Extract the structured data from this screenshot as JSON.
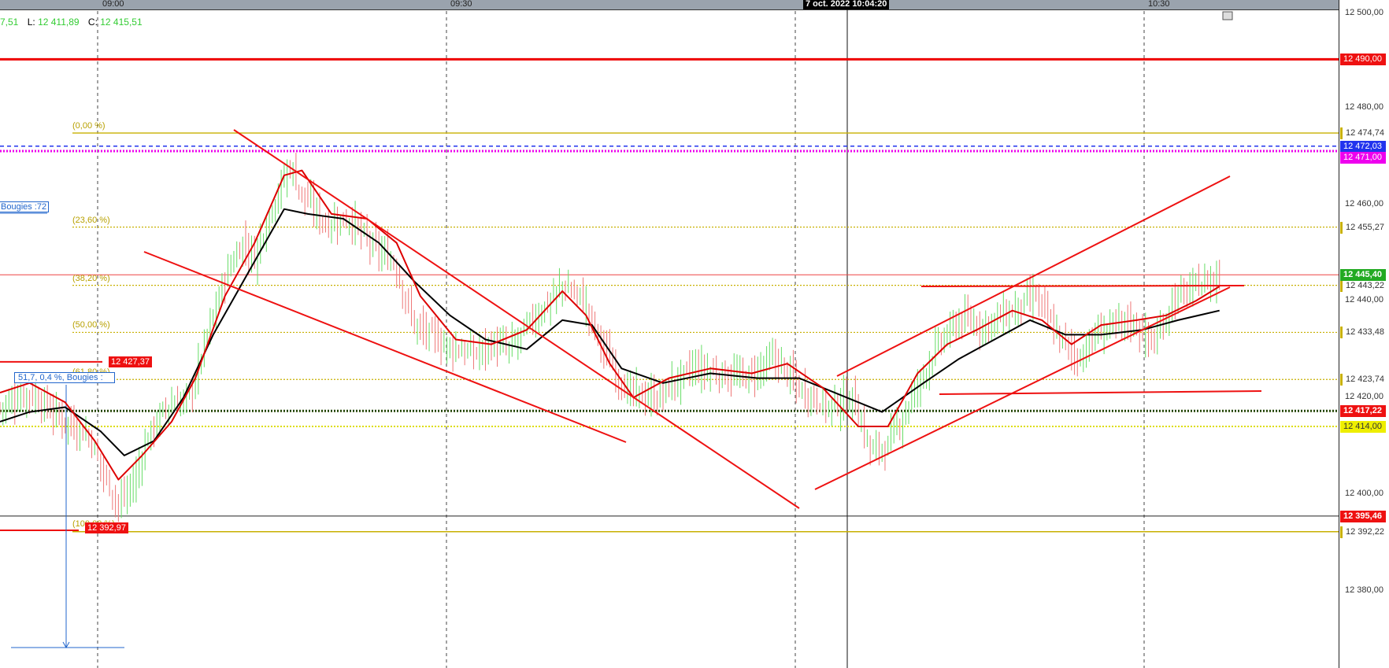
{
  "window": {
    "ohlc_prefix_value": "7,51",
    "ohlc_low_label": "L:",
    "ohlc_low": "12 411,89",
    "ohlc_close_label": "C:",
    "ohlc_close": "12 415,51",
    "cursor_time": "7 oct. 2022 10:04:20",
    "bougies_label": "Bougies :72",
    "measure_label": "51,7, 0,4 %, Bougies :"
  },
  "colors": {
    "up": "#66dd66",
    "down": "#ee7777",
    "trendline": "#ee1111",
    "fibo": "#c8b000",
    "ma_fast": "#dd0000",
    "ma_slow": "#000000",
    "resistance": "#ee0000",
    "magenta": "#ee00ee",
    "blue_dash": "#2233ee",
    "yellow_dot": "#dddd00",
    "dark_dot": "#224400"
  },
  "chart_data": {
    "type": "candlestick",
    "title": "",
    "y_axis_ticks": [
      "12 500,00",
      "12 480,00",
      "12 460,00",
      "12 440,00",
      "12 420,00",
      "12 400,00",
      "12 380,00"
    ],
    "y_tick_values": [
      12500,
      12480,
      12460,
      12440,
      12420,
      12400,
      12380
    ],
    "ylim": [
      12364,
      12500
    ],
    "x_axis_ticks": [
      "09:00",
      "09:30",
      "10:30"
    ],
    "grid": "dashed-vertical",
    "fibonacci_levels": [
      {
        "label": "(0,00 %)",
        "price": 12474.74,
        "price_label": "12 474,74"
      },
      {
        "label": "(23,60 %)",
        "price": 12455.27,
        "price_label": "12 455,27"
      },
      {
        "label": "(38,20 %)",
        "price": 12443.22,
        "price_label": "12 443,22"
      },
      {
        "label": "(50,00 %)",
        "price": 12433.48,
        "price_label": "12 433,48"
      },
      {
        "label": "(61,80 %)",
        "price": 12423.74,
        "price_label": "12 423,74"
      },
      {
        "label": "(100,00 %)",
        "price": 12392.22,
        "price_label": "12 392,22"
      }
    ],
    "price_labels": [
      {
        "price": 12490.0,
        "text": "12 490,00",
        "bg": "#ee1111",
        "fg": "#ffffff"
      },
      {
        "price": 12472.03,
        "text": "12 472,03",
        "bg": "#2233ee",
        "fg": "#ffffff"
      },
      {
        "price": 12471.0,
        "text": "12 471,00",
        "bg": "#ee00ee",
        "fg": "#ffffff"
      },
      {
        "price": 12445.4,
        "text": "12 445,40",
        "bg": "#22aa22",
        "fg": "#ffffff"
      },
      {
        "price": 12417.22,
        "text": "12 417,22",
        "bg": "#ee1111",
        "fg": "#ffffff"
      },
      {
        "price": 12414.0,
        "text": "12 414,00",
        "bg": "#eeee00",
        "fg": "#333333"
      },
      {
        "price": 12395.46,
        "text": "12 395,46",
        "bg": "#ee1111",
        "fg": "#ffffff"
      }
    ],
    "marker_labels": [
      {
        "text": "12 427,37",
        "price": 12427.37
      },
      {
        "text": "12 392,97",
        "price": 12392.97
      }
    ],
    "close_path": [
      [
        0,
        12418
      ],
      [
        10,
        12421
      ],
      [
        20,
        12416
      ],
      [
        30,
        12412
      ],
      [
        36,
        12403
      ],
      [
        40,
        12398
      ],
      [
        45,
        12402
      ],
      [
        50,
        12412
      ],
      [
        56,
        12418
      ],
      [
        60,
        12419
      ],
      [
        64,
        12420
      ],
      [
        70,
        12433
      ],
      [
        76,
        12445
      ],
      [
        82,
        12452
      ],
      [
        86,
        12449
      ],
      [
        92,
        12460
      ],
      [
        98,
        12468
      ],
      [
        102,
        12462
      ],
      [
        110,
        12456
      ],
      [
        118,
        12457
      ],
      [
        126,
        12451
      ],
      [
        133,
        12448
      ],
      [
        140,
        12435
      ],
      [
        150,
        12431
      ],
      [
        160,
        12429
      ],
      [
        166,
        12431
      ],
      [
        172,
        12430
      ],
      [
        180,
        12436
      ],
      [
        190,
        12443
      ],
      [
        196,
        12441
      ],
      [
        204,
        12430
      ],
      [
        212,
        12421
      ],
      [
        222,
        12420
      ],
      [
        234,
        12426
      ],
      [
        242,
        12425
      ],
      [
        252,
        12424
      ],
      [
        262,
        12428
      ],
      [
        270,
        12422
      ],
      [
        280,
        12418
      ],
      [
        288,
        12420
      ],
      [
        294,
        12409
      ],
      [
        300,
        12410
      ],
      [
        308,
        12420
      ],
      [
        316,
        12430
      ],
      [
        324,
        12436
      ],
      [
        332,
        12435
      ],
      [
        340,
        12437
      ],
      [
        350,
        12441
      ],
      [
        356,
        12434
      ],
      [
        364,
        12428
      ],
      [
        372,
        12434
      ],
      [
        382,
        12436
      ],
      [
        390,
        12431
      ],
      [
        396,
        12440
      ],
      [
        404,
        12443
      ],
      [
        412,
        12445
      ]
    ],
    "ma_fast": [
      [
        0,
        12421
      ],
      [
        10,
        12423
      ],
      [
        22,
        12419
      ],
      [
        32,
        12411
      ],
      [
        40,
        12403
      ],
      [
        48,
        12408
      ],
      [
        58,
        12415
      ],
      [
        66,
        12424
      ],
      [
        76,
        12441
      ],
      [
        86,
        12452
      ],
      [
        96,
        12466
      ],
      [
        102,
        12467
      ],
      [
        112,
        12458
      ],
      [
        124,
        12457
      ],
      [
        134,
        12452
      ],
      [
        142,
        12441
      ],
      [
        154,
        12432
      ],
      [
        166,
        12431
      ],
      [
        178,
        12434
      ],
      [
        190,
        12442
      ],
      [
        198,
        12437
      ],
      [
        206,
        12427
      ],
      [
        214,
        12420
      ],
      [
        226,
        12424
      ],
      [
        240,
        12426
      ],
      [
        254,
        12425
      ],
      [
        266,
        12427
      ],
      [
        278,
        12422
      ],
      [
        290,
        12414
      ],
      [
        300,
        12414
      ],
      [
        310,
        12425
      ],
      [
        320,
        12431
      ],
      [
        330,
        12434
      ],
      [
        342,
        12438
      ],
      [
        352,
        12436
      ],
      [
        362,
        12431
      ],
      [
        372,
        12435
      ],
      [
        384,
        12436
      ],
      [
        394,
        12437
      ],
      [
        404,
        12440
      ],
      [
        412,
        12443
      ]
    ],
    "ma_slow": [
      [
        0,
        12415
      ],
      [
        10,
        12417
      ],
      [
        22,
        12418
      ],
      [
        34,
        12413
      ],
      [
        42,
        12408
      ],
      [
        52,
        12411
      ],
      [
        62,
        12420
      ],
      [
        72,
        12433
      ],
      [
        84,
        12446
      ],
      [
        96,
        12459
      ],
      [
        104,
        12458
      ],
      [
        116,
        12457
      ],
      [
        128,
        12452
      ],
      [
        140,
        12444
      ],
      [
        152,
        12437
      ],
      [
        164,
        12432
      ],
      [
        178,
        12430
      ],
      [
        190,
        12436
      ],
      [
        200,
        12435
      ],
      [
        210,
        12426
      ],
      [
        224,
        12423
      ],
      [
        240,
        12425
      ],
      [
        256,
        12424
      ],
      [
        270,
        12424
      ],
      [
        286,
        12420
      ],
      [
        298,
        12417
      ],
      [
        312,
        12423
      ],
      [
        324,
        12428
      ],
      [
        336,
        12432
      ],
      [
        348,
        12436
      ],
      [
        360,
        12433
      ],
      [
        372,
        12433
      ],
      [
        386,
        12434
      ],
      [
        398,
        12436
      ],
      [
        412,
        12438
      ]
    ]
  }
}
